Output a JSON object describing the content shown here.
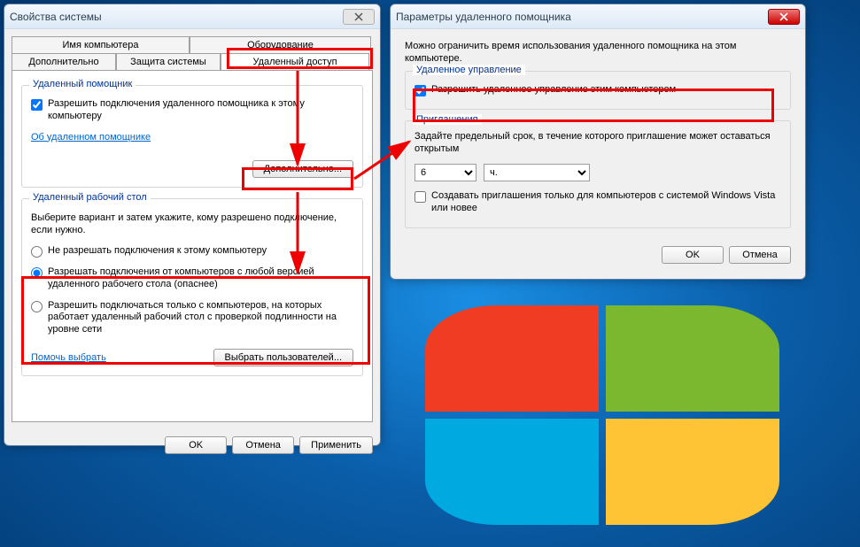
{
  "propWindow": {
    "title": "Свойства системы",
    "tabs": {
      "computer_name": "Имя компьютера",
      "hardware": "Оборудование",
      "advanced": "Дополнительно",
      "system_protection": "Защита системы",
      "remote": "Удаленный доступ"
    },
    "group_assistant": {
      "legend": "Удаленный помощник",
      "allow_label": "Разрешить подключения удаленного помощника к этому компьютеру",
      "about_link": "Об удаленном помощнике",
      "advanced_button": "Дополнительно..."
    },
    "group_rdp": {
      "legend": "Удаленный рабочий стол",
      "instruction": "Выберите вариант и затем укажите, кому разрешено подключение, если нужно.",
      "option_deny": "Не разрешать подключения к этому компьютеру",
      "option_any": "Разрешать подключения от компьютеров с любой версией удаленного рабочего стола (опаснее)",
      "option_nla": "Разрешить подключаться только с компьютеров, на которых работает удаленный рабочий стол с проверкой подлинности на уровне сети",
      "help_link": "Помочь выбрать",
      "select_users_button": "Выбрать пользователей..."
    },
    "buttons": {
      "ok": "OK",
      "cancel": "Отмена",
      "apply": "Применить"
    }
  },
  "assistWindow": {
    "title": "Параметры удаленного помощника",
    "intro": "Можно ограничить время использования удаленного помощника на этом компьютере.",
    "group_control": {
      "legend": "Удаленное управление",
      "allow_label": "Разрешить удаленное управление этим компьютером"
    },
    "group_invite": {
      "legend": "Приглашения",
      "instruction": "Задайте предельный срок, в течение которого приглашение может оставаться открытым",
      "value_number": "6",
      "value_unit": "ч.",
      "vista_label": "Создавать приглашения только для компьютеров с системой Windows Vista или новее"
    },
    "buttons": {
      "ok": "OK",
      "cancel": "Отмена"
    }
  }
}
